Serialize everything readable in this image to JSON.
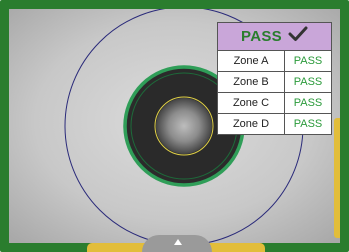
{
  "inspection": {
    "overall_result": "PASS",
    "result_icon": "checkmark-icon",
    "zones": [
      {
        "name": "Zone A",
        "status": "PASS"
      },
      {
        "name": "Zone B",
        "status": "PASS"
      },
      {
        "name": "Zone C",
        "status": "PASS"
      },
      {
        "name": "Zone D",
        "status": "PASS"
      }
    ]
  },
  "colors": {
    "frame": "#2a7d2e",
    "result_header": "#c9a6d9",
    "pass_text": "#2a9a3a",
    "scroll_indicator": "#e2bd3a"
  }
}
